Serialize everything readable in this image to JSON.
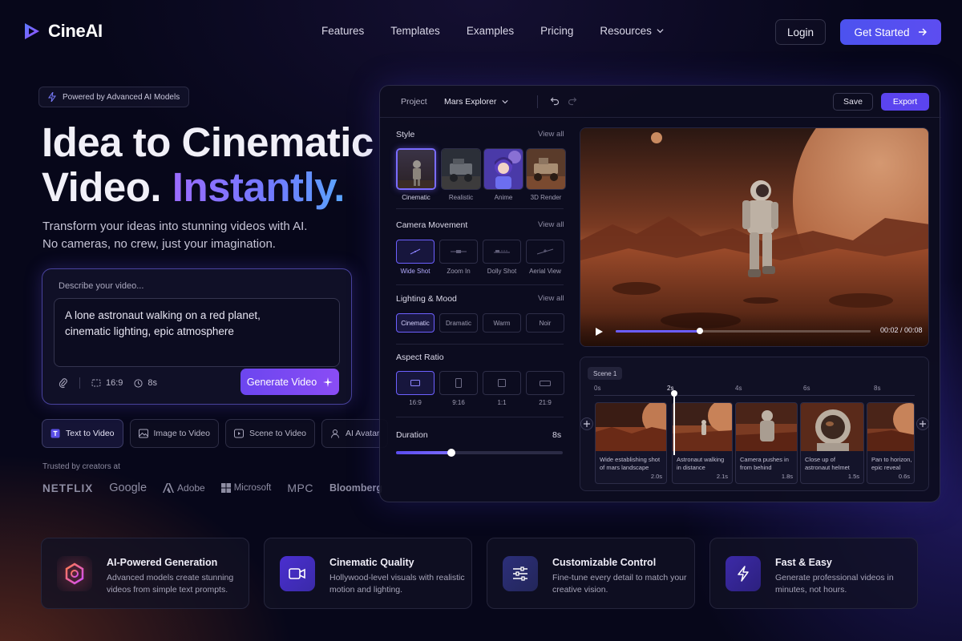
{
  "app": {
    "name": "CineAI"
  },
  "nav": {
    "items": [
      "Features",
      "Templates",
      "Examples",
      "Pricing"
    ],
    "resources_label": "Resources",
    "login_label": "Login",
    "get_started_label": "Get Started"
  },
  "hero": {
    "badge": "Powered by Advanced AI Models",
    "title_line1": "Idea to Cinematic",
    "title_line2_plain": "Video. ",
    "title_line2_accent": "Instantly.",
    "subtitle_line1": "Transform your ideas into stunning videos with AI.",
    "subtitle_line2": "No cameras, no crew, just your imagination."
  },
  "prompt": {
    "label": "Describe your video...",
    "text_line1": "A lone astronaut walking on a red planet,",
    "text_line2": "cinematic lighting, epic atmosphere",
    "aspect": "16:9",
    "duration": "8s",
    "generate_label": "Generate Video"
  },
  "modes": [
    {
      "label": "Text to Video",
      "icon": "text-icon",
      "active": true
    },
    {
      "label": "Image to Video",
      "icon": "image-icon",
      "active": false
    },
    {
      "label": "Scene to Video",
      "icon": "scene-icon",
      "active": false
    },
    {
      "label": "AI Avatar",
      "icon": "avatar-icon",
      "active": false
    }
  ],
  "trusted": {
    "label": "Trusted by creators at",
    "brands": [
      "NETFLIX",
      "Google",
      "Adobe",
      "Microsoft",
      "MPC",
      "Bloomberg"
    ]
  },
  "editor": {
    "project_label": "Project",
    "project_name": "Mars Explorer",
    "save_label": "Save",
    "export_label": "Export",
    "view_all": "View all",
    "style": {
      "title": "Style",
      "options": [
        "Cinematic",
        "Realistic",
        "Anime",
        "3D Render"
      ],
      "selected": "Cinematic"
    },
    "camera": {
      "title": "Camera Movement",
      "options": [
        "Wide Shot",
        "Zoom In",
        "Dolly Shot",
        "Aerial View"
      ],
      "selected": "Wide Shot"
    },
    "lighting": {
      "title": "Lighting & Mood",
      "options": [
        "Cinematic",
        "Dramatic",
        "Warm",
        "Noir"
      ],
      "selected": "Cinematic"
    },
    "aspect": {
      "title": "Aspect Ratio",
      "options": [
        "16:9",
        "9:16",
        "1:1",
        "21:9"
      ],
      "selected": "16:9"
    },
    "duration": {
      "title": "Duration",
      "value": "8s",
      "fraction": 0.33
    },
    "player": {
      "time": "00:02 / 00:08",
      "progress": 0.33
    },
    "timeline": {
      "scene_label": "Scene 1",
      "ticks": [
        "0s",
        "2s",
        "4s",
        "6s",
        "8s"
      ],
      "playhead_fraction": 0.25,
      "clips": [
        {
          "caption": "Wide establishing shot of mars landscape",
          "duration": "2.0s"
        },
        {
          "caption": "Astronaut walking in distance",
          "duration": "2.1s"
        },
        {
          "caption": "Camera pushes in from behind",
          "duration": "1.8s"
        },
        {
          "caption": "Close up of astronaut helmet",
          "duration": "1.5s"
        },
        {
          "caption": "Pan to horizon, epic reveal",
          "duration": "0.6s"
        }
      ]
    }
  },
  "features": [
    {
      "title": "AI-Powered Generation",
      "desc": "Advanced models create stunning videos from simple text prompts.",
      "icon": "hexagon-icon"
    },
    {
      "title": "Cinematic Quality",
      "desc": "Hollywood-level visuals with realistic motion and lighting.",
      "icon": "video-camera-icon"
    },
    {
      "title": "Customizable Control",
      "desc": "Fine-tune every detail to match your creative vision.",
      "icon": "sliders-icon"
    },
    {
      "title": "Fast & Easy",
      "desc": "Generate professional videos in minutes, not hours.",
      "icon": "lightning-icon"
    }
  ],
  "colors": {
    "accent": "#5b44ef",
    "accent_light": "#7a6cff",
    "background": "#07071a",
    "mars": "#b4512a"
  }
}
